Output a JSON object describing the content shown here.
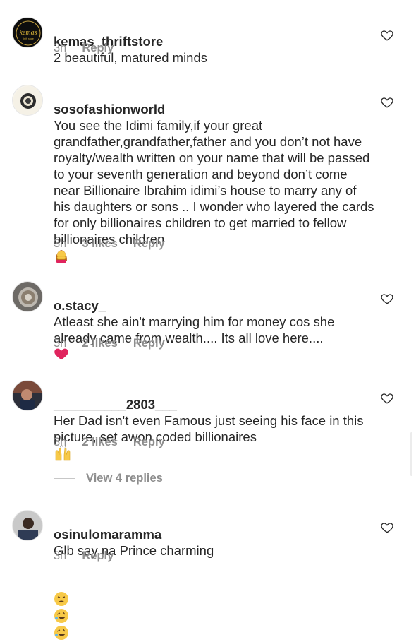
{
  "comments": [
    {
      "username": "kemas_thriftstore",
      "text": "2 beautiful, matured minds",
      "time": "3h",
      "likes": "",
      "reply_label": "Reply",
      "avatar_text": "kemas"
    },
    {
      "username": "sosofashionworld",
      "text": "You see the Idimi family,if your great grandfather,grandfather,father and you don’t not have royalty/wealth written on your name that will be passed to your seventh generation and beyond don’t come near Billionaire Ibrahim idimi’s house to marry any of his daughters or sons .. I wonder who layered the cards for only billionaires children to get married to fellow billionaires children",
      "time": "3h",
      "likes": "3 likes",
      "reply_label": "Reply"
    },
    {
      "username": "o.stacy_",
      "text": "Atleast she ain't marrying him for money cos she already came from wealth.... Its all love here....",
      "time": "3h",
      "likes": "2 likes",
      "reply_label": "Reply"
    },
    {
      "username": "__________2803___",
      "text": "Her Dad isn't even Famous just seeing his face in this picture, set awon coded billionaires",
      "time": "3h",
      "likes": "2 likes",
      "reply_label": "Reply"
    },
    {
      "username": "osinulomaramma",
      "text": "Glb say na Prince charming",
      "time": "3h",
      "likes": "",
      "reply_label": "Reply"
    }
  ],
  "view_replies": "View 4 replies",
  "icons": {
    "like": "heart-outline-icon"
  },
  "colors": {
    "text": "#262626",
    "muted": "#8e8e8e",
    "heart_red": "#e0245e"
  }
}
